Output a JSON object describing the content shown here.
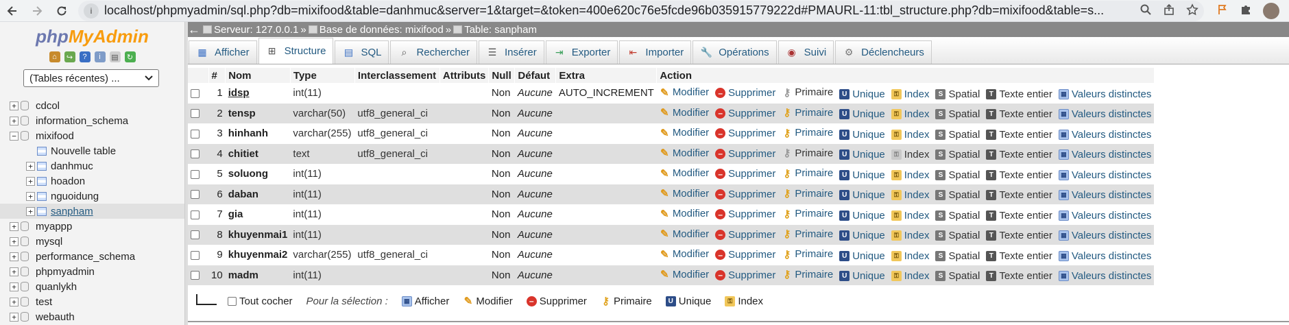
{
  "browser": {
    "url": "localhost/phpmyadmin/sql.php?db=mixifood&table=danhmuc&server=1&target=&token=400e620c76e5fcde96b035915779222d#PMAURL-11:tbl_structure.php?db=mixifood&table=s..."
  },
  "sidebar": {
    "logo_php": "php",
    "logo_my": "MyAdmin",
    "recent_select": "(Tables récentes) ...",
    "databases": [
      {
        "name": "cdcol",
        "expander": "+"
      },
      {
        "name": "information_schema",
        "expander": "+"
      },
      {
        "name": "mixifood",
        "expander": "−"
      }
    ],
    "mixifood_children": [
      {
        "name": "Nouvelle table"
      },
      {
        "name": "danhmuc",
        "expander": "+"
      },
      {
        "name": "hoadon",
        "expander": "+"
      },
      {
        "name": "nguoidung",
        "expander": "+"
      },
      {
        "name": "sanpham",
        "expander": "+"
      }
    ],
    "other_databases": [
      {
        "name": "myappp",
        "expander": "+"
      },
      {
        "name": "mysql",
        "expander": "+"
      },
      {
        "name": "performance_schema",
        "expander": "+"
      },
      {
        "name": "phpmyadmin",
        "expander": "+"
      },
      {
        "name": "quanlykh",
        "expander": "+"
      },
      {
        "name": "test",
        "expander": "+"
      },
      {
        "name": "webauth",
        "expander": "+"
      }
    ]
  },
  "breadcrumb": {
    "server": "Serveur: 127.0.0.1",
    "database": "Base de données: mixifood",
    "table": "Table: sanpham"
  },
  "tabs": [
    {
      "label": "Afficher",
      "icon": "browse-icon"
    },
    {
      "label": "Structure",
      "icon": "structure-icon"
    },
    {
      "label": "SQL",
      "icon": "sql-icon"
    },
    {
      "label": "Rechercher",
      "icon": "search-icon"
    },
    {
      "label": "Insérer",
      "icon": "insert-icon"
    },
    {
      "label": "Exporter",
      "icon": "export-icon"
    },
    {
      "label": "Importer",
      "icon": "import-icon"
    },
    {
      "label": "Opérations",
      "icon": "wrench-icon"
    },
    {
      "label": "Suivi",
      "icon": "eye-icon"
    },
    {
      "label": "Déclencheurs",
      "icon": "triggers-icon"
    }
  ],
  "table": {
    "headers": [
      "#",
      "Nom",
      "Type",
      "Interclassement",
      "Attributs",
      "Null",
      "Défaut",
      "Extra",
      "Action"
    ],
    "rows": [
      {
        "num": "1",
        "name": "idsp",
        "type": "int(11)",
        "collation": "",
        "attributes": "",
        "null": "Non",
        "default": "Aucune",
        "extra": "AUTO_INCREMENT",
        "primary_disabled": true,
        "index_disabled": false
      },
      {
        "num": "2",
        "name": "tensp",
        "type": "varchar(50)",
        "collation": "utf8_general_ci",
        "attributes": "",
        "null": "Non",
        "default": "Aucune",
        "extra": "",
        "primary_disabled": false,
        "index_disabled": false
      },
      {
        "num": "3",
        "name": "hinhanh",
        "type": "varchar(255)",
        "collation": "utf8_general_ci",
        "attributes": "",
        "null": "Non",
        "default": "Aucune",
        "extra": "",
        "primary_disabled": false,
        "index_disabled": false
      },
      {
        "num": "4",
        "name": "chitiet",
        "type": "text",
        "collation": "utf8_general_ci",
        "attributes": "",
        "null": "Non",
        "default": "Aucune",
        "extra": "",
        "primary_disabled": true,
        "index_disabled": true
      },
      {
        "num": "5",
        "name": "soluong",
        "type": "int(11)",
        "collation": "",
        "attributes": "",
        "null": "Non",
        "default": "Aucune",
        "extra": "",
        "primary_disabled": false,
        "index_disabled": false
      },
      {
        "num": "6",
        "name": "daban",
        "type": "int(11)",
        "collation": "",
        "attributes": "",
        "null": "Non",
        "default": "Aucune",
        "extra": "",
        "primary_disabled": false,
        "index_disabled": false
      },
      {
        "num": "7",
        "name": "gia",
        "type": "int(11)",
        "collation": "",
        "attributes": "",
        "null": "Non",
        "default": "Aucune",
        "extra": "",
        "primary_disabled": false,
        "index_disabled": false
      },
      {
        "num": "8",
        "name": "khuyenmai1",
        "type": "int(11)",
        "collation": "",
        "attributes": "",
        "null": "Non",
        "default": "Aucune",
        "extra": "",
        "primary_disabled": false,
        "index_disabled": false
      },
      {
        "num": "9",
        "name": "khuyenmai2",
        "type": "varchar(255)",
        "collation": "utf8_general_ci",
        "attributes": "",
        "null": "Non",
        "default": "Aucune",
        "extra": "",
        "primary_disabled": false,
        "index_disabled": false
      },
      {
        "num": "10",
        "name": "madm",
        "type": "int(11)",
        "collation": "",
        "attributes": "",
        "null": "Non",
        "default": "Aucune",
        "extra": "",
        "primary_disabled": false,
        "index_disabled": false
      }
    ],
    "actions": {
      "modify": "Modifier",
      "delete": "Supprimer",
      "primary": "Primaire",
      "unique": "Unique",
      "index": "Index",
      "spatial": "Spatial",
      "fulltext": "Texte entier",
      "distinct": "Valeurs distinctes"
    }
  },
  "selection_bar": {
    "check_all": "Tout cocher",
    "for_selection": "Pour la sélection :",
    "browse": "Afficher",
    "modify": "Modifier",
    "delete": "Supprimer",
    "primary": "Primaire",
    "unique": "Unique",
    "index": "Index"
  },
  "colors": {
    "link": "#235a81",
    "breadcrumb_bg": "#888888",
    "row_even": "#dfdfdf"
  }
}
